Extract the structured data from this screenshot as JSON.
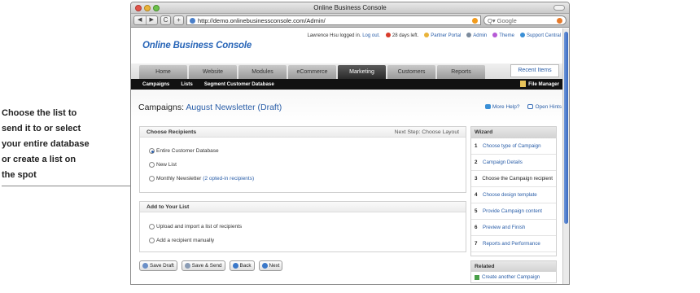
{
  "annotation": {
    "lines": [
      "Choose the list to",
      "send it to  or select",
      "your entire database",
      "or create a list on",
      "the spot"
    ]
  },
  "browser": {
    "title": "Online Business Console",
    "url": "http://demo.onlinebusinessconsole.com/Admin/",
    "search_placeholder": "Google",
    "back_glyph": "◀",
    "forward_glyph": "▶",
    "reload_glyph": "C",
    "add_glyph": "+",
    "search_glyph": "Q▾"
  },
  "app": {
    "logo": "Online Business Console",
    "user_text": "Lawrence Hsu logged in.",
    "logout": "Log out.",
    "days_left": "28 days left.",
    "links": [
      "Partner Portal",
      "Admin",
      "Theme",
      "Support Central"
    ],
    "colors": {
      "accent": "#2966b8",
      "link": "#2a5ea8",
      "nav_dark": "#111111"
    }
  },
  "nav": {
    "tabs": [
      "Home",
      "Website",
      "Modules",
      "eCommerce",
      "Marketing",
      "Customers",
      "Reports"
    ],
    "active": "Marketing",
    "recent": "Recent Items"
  },
  "subnav": {
    "items": [
      "Campaigns",
      "Lists",
      "Segment Customer Database"
    ],
    "file_manager": "File Manager"
  },
  "page": {
    "title_prefix": "Campaigns:",
    "campaign_name": "August Newsletter (Draft)",
    "help": "More Help?",
    "hints": "Open Hints"
  },
  "recipients": {
    "heading": "Choose Recipients",
    "next_step": "Next Step: Choose Layout",
    "options": [
      {
        "label": "Entire Customer Database",
        "note": "",
        "checked": true
      },
      {
        "label": "New List",
        "note": "",
        "checked": false
      },
      {
        "label": "Monthly Newsletter",
        "note": "(2 opted-in recipients)",
        "checked": false
      }
    ]
  },
  "add_list": {
    "heading": "Add to Your List",
    "options": [
      "Upload and import a list of recipients",
      "Add a recipient manually"
    ]
  },
  "wizard": {
    "heading": "Wizard",
    "steps": [
      {
        "num": "1",
        "label": "Choose type of Campaign"
      },
      {
        "num": "2",
        "label": "Campaign Details"
      },
      {
        "num": "3",
        "label": "Choose the Campaign recipient"
      },
      {
        "num": "4",
        "label": "Choose design template"
      },
      {
        "num": "5",
        "label": "Provide Campaign content"
      },
      {
        "num": "6",
        "label": "Preview and Finish"
      },
      {
        "num": "7",
        "label": "Reports and Performance"
      }
    ],
    "current_step": "3"
  },
  "related": {
    "heading": "Related",
    "item": "Create another Campaign"
  },
  "buttons": {
    "save_draft": "Save Draft",
    "save_send": "Save & Send",
    "back": "Back",
    "next": "Next"
  }
}
